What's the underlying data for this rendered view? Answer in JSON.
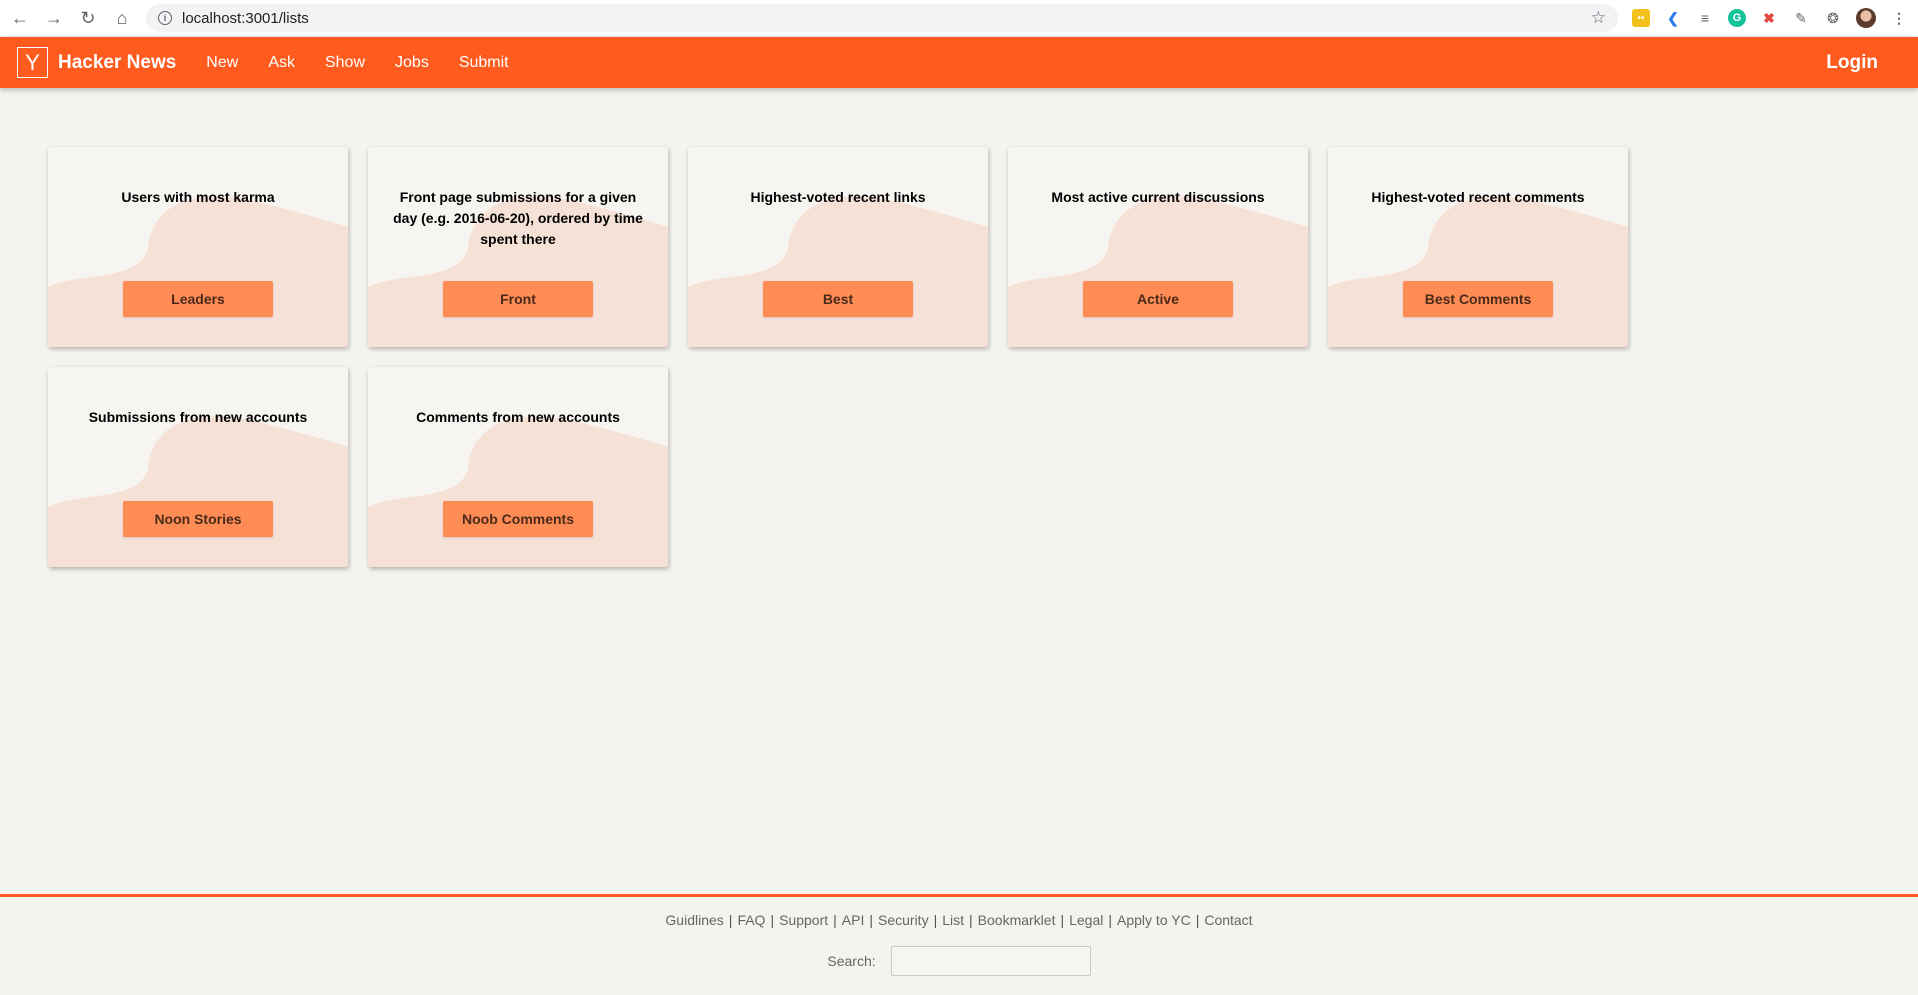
{
  "browser": {
    "url": "localhost:3001/lists"
  },
  "header": {
    "logo": "Y",
    "title": "Hacker News",
    "nav": [
      "New",
      "Ask",
      "Show",
      "Jobs",
      "Submit"
    ],
    "login": "Login",
    "accent_color": "#ff5b1f"
  },
  "cards": [
    {
      "title": "Users with most karma",
      "button": "Leaders"
    },
    {
      "title": "Front page submissions for a given day (e.g. 2016-06-20), ordered by time spent there",
      "button": "Front"
    },
    {
      "title": "Highest-voted recent links",
      "button": "Best"
    },
    {
      "title": "Most active current discussions",
      "button": "Active"
    },
    {
      "title": "Highest-voted recent comments",
      "button": "Best Comments"
    },
    {
      "title": "Submissions from new accounts",
      "button": "Noon Stories"
    },
    {
      "title": "Comments from new accounts",
      "button": "Noob Comments"
    }
  ],
  "footer": {
    "links": [
      "Guidlines",
      "FAQ",
      "Support",
      "API",
      "Security",
      "List",
      "Bookmarklet",
      "Legal",
      "Apply to YC",
      "Contact"
    ],
    "search_label": "Search:",
    "search_value": ""
  }
}
